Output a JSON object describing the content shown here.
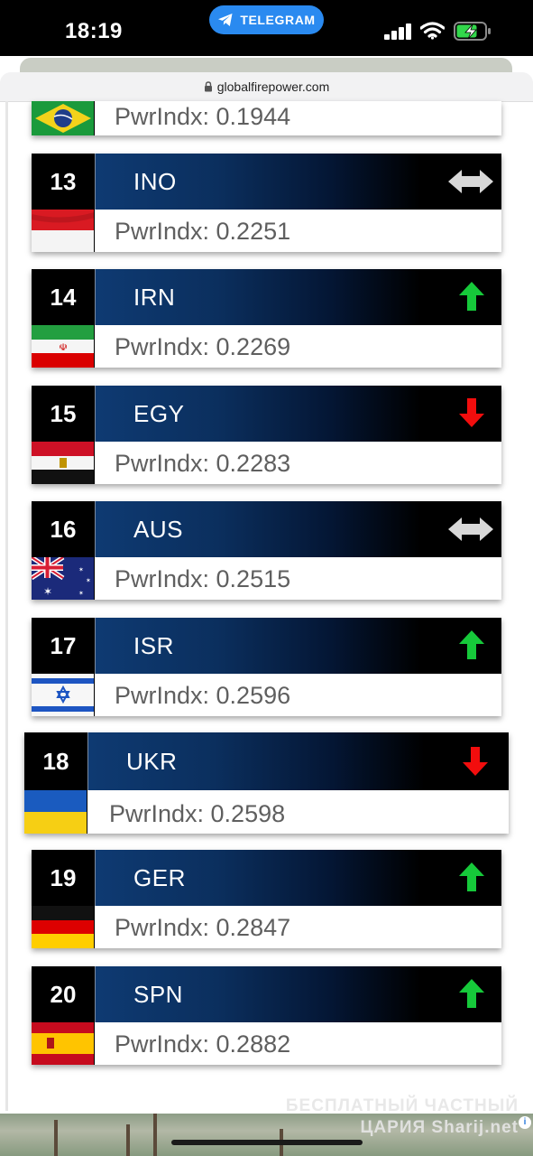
{
  "status_bar": {
    "time": "18:19",
    "app_pill": "TELEGRAM",
    "icons": [
      "cellular-signal-icon",
      "wifi-icon",
      "battery-charging-icon"
    ]
  },
  "browser": {
    "url": "globalfirepower.com"
  },
  "partial_entry": {
    "country_flag": "brazil",
    "pwr_label": "PwrIndx: 0.1944"
  },
  "rankings": [
    {
      "rank": "13",
      "code": "INO",
      "pwr_label": "PwrIndx: 0.2251",
      "trend": "unchanged",
      "flag": "indonesia"
    },
    {
      "rank": "14",
      "code": "IRN",
      "pwr_label": "PwrIndx: 0.2269",
      "trend": "up",
      "flag": "iran"
    },
    {
      "rank": "15",
      "code": "EGY",
      "pwr_label": "PwrIndx: 0.2283",
      "trend": "down",
      "flag": "egypt"
    },
    {
      "rank": "16",
      "code": "AUS",
      "pwr_label": "PwrIndx: 0.2515",
      "trend": "unchanged",
      "flag": "australia"
    },
    {
      "rank": "17",
      "code": "ISR",
      "pwr_label": "PwrIndx: 0.2596",
      "trend": "up",
      "flag": "israel"
    },
    {
      "rank": "18",
      "code": "UKR",
      "pwr_label": "PwrIndx: 0.2598",
      "trend": "down",
      "flag": "ukraine",
      "highlighted": true
    },
    {
      "rank": "19",
      "code": "GER",
      "pwr_label": "PwrIndx: 0.2847",
      "trend": "up",
      "flag": "germany"
    },
    {
      "rank": "20",
      "code": "SPN",
      "pwr_label": "PwrIndx: 0.2882",
      "trend": "up",
      "flag": "spain"
    }
  ],
  "colors": {
    "trend_up": "#16c93a",
    "trend_down": "#f20d0d",
    "trend_unchanged": "#d8d8d8",
    "name_bar_start": "#0e3a72",
    "name_bar_end": "#000000"
  },
  "watermark": {
    "line1": "БЕСПЛАТНЫЙ ЧАСТНЫЙ",
    "line2": "ЦАРИЯ Sharij.net"
  }
}
